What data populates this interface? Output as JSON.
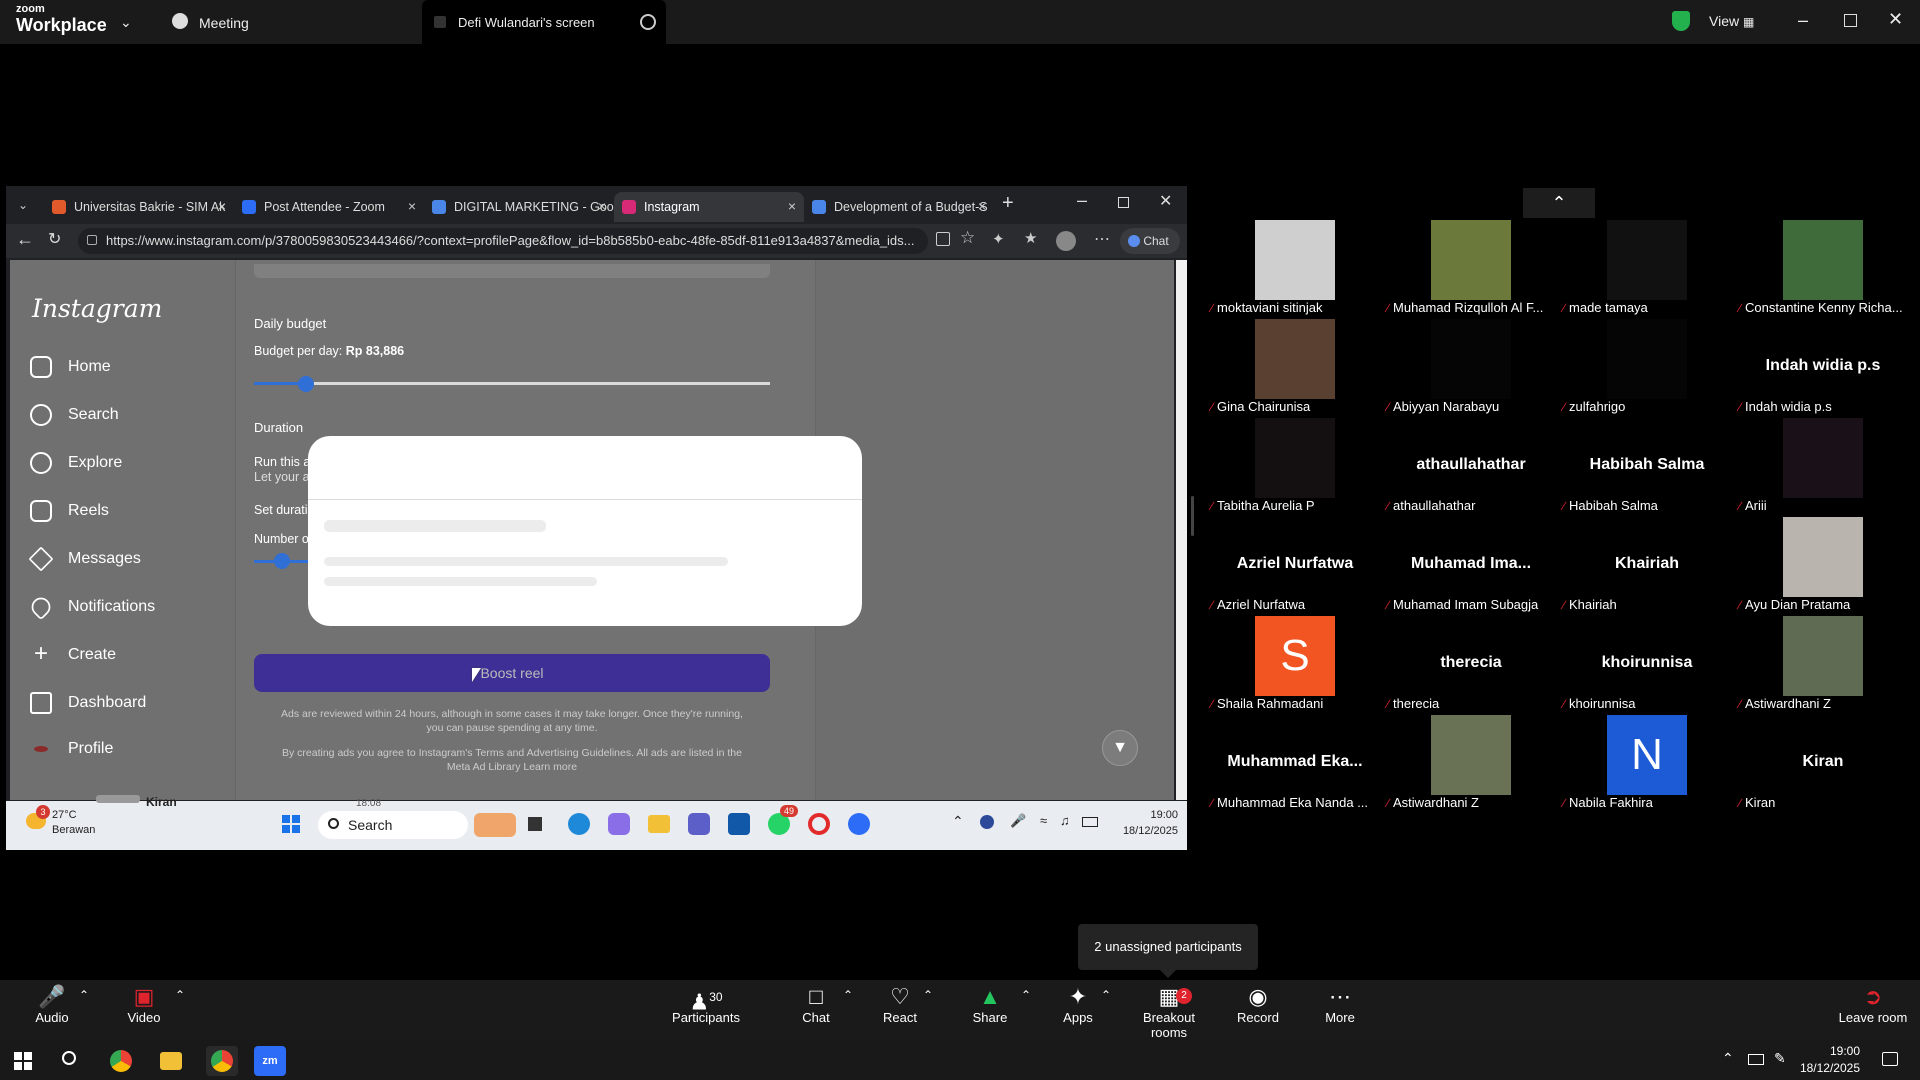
{
  "zoom": {
    "logo_top": "zoom",
    "logo_bottom": "Workplace",
    "meeting_label": "Meeting",
    "share_tab_label": "Defi Wulandari's screen",
    "view_label": "View"
  },
  "browser": {
    "tabs": [
      {
        "label": "Universitas Bakrie - SIM Ak",
        "color": "#e05a2b"
      },
      {
        "label": "Post Attendee - Zoom",
        "color": "#2d6cf6"
      },
      {
        "label": "DIGITAL MARKETING - Goo",
        "color": "#4a86e8"
      },
      {
        "label": "Instagram",
        "color": "#d62976"
      },
      {
        "label": "Development of a Budget-S",
        "color": "#4a86e8"
      }
    ],
    "url": "https://www.instagram.com/p/3780059830523443466/?context=profilePage&flow_id=b8b585b0-eabc-48fe-85df-811e913a4837&media_ids...",
    "chat_label": "Chat"
  },
  "instagram": {
    "logo": "Instagram",
    "nav": [
      "Home",
      "Search",
      "Explore",
      "Reels",
      "Messages",
      "Notifications",
      "Create",
      "Dashboard",
      "Profile"
    ],
    "daily_budget_label": "Daily budget",
    "budget_per_day_label": "Budget per day:",
    "budget_value": "Rp 83,886",
    "duration_label": "Duration",
    "run_this_label": "Run this ad",
    "let_your_label": "Let your ad",
    "set_duration_label": "Set duration",
    "number_of_label": "Number of",
    "boost_button": "Boost reel",
    "review_text_1": "Ads are reviewed within 24 hours, although in some cases it may take longer. Once they're running,",
    "review_text_2": "you can pause spending at any time.",
    "terms_text_1": "By creating ads you agree to Instagram's Terms and Advertising Guidelines. All ads are listed in the",
    "terms_text_2": "Meta Ad Library Learn more",
    "budget_slider_level": 0.1
  },
  "inner_taskbar": {
    "weather_temp": "27°C",
    "weather_desc": "Berawan",
    "search_label": "Search",
    "time": "19:00",
    "date": "18/12/2025",
    "badge": "49",
    "notif": "3",
    "peek_name": "Kiran",
    "peek_time": "18:08"
  },
  "participants": [
    {
      "name": "moktaviani sitinjak",
      "type": "video",
      "color": "#cfcfcf"
    },
    {
      "name": "Muhamad Rizqulloh Al F...",
      "type": "video",
      "color": "#6b7a3a"
    },
    {
      "name": "made tamaya",
      "type": "video",
      "color": "#111111"
    },
    {
      "name": "Constantine Kenny Richa...",
      "type": "video",
      "color": "#3f6a3a"
    },
    {
      "name": "Gina Chairunisa",
      "type": "video",
      "color": "#5a4030"
    },
    {
      "name": "Abiyyan Narabayu",
      "type": "video",
      "color": "#050505"
    },
    {
      "name": "zulfahrigo",
      "type": "video",
      "color": "#050505"
    },
    {
      "name": "Indah widia p.s",
      "type": "text",
      "big": "Indah widia p.s"
    },
    {
      "name": "Tabitha Aurelia P",
      "type": "video",
      "color": "#141012"
    },
    {
      "name": "athaullahathar",
      "type": "text",
      "big": "athaullahathar"
    },
    {
      "name": "Habibah Salma",
      "type": "text",
      "big": "Habibah Salma"
    },
    {
      "name": "Ariii",
      "type": "video",
      "color": "#1a1018"
    },
    {
      "name": "Azriel Nurfatwa",
      "type": "text",
      "big": "Azriel Nurfatwa"
    },
    {
      "name": "Muhamad Imam Subagja",
      "type": "text",
      "big": "Muhamad  Ima..."
    },
    {
      "name": "Khairiah",
      "type": "text",
      "big": "Khairiah"
    },
    {
      "name": "Ayu Dian Pratama",
      "type": "video",
      "color": "#b9b4ad"
    },
    {
      "name": "Shaila Rahmadani",
      "type": "avatar",
      "letter": "S",
      "color": "#f25522"
    },
    {
      "name": "therecia",
      "type": "text",
      "big": "therecia"
    },
    {
      "name": "khoirunnisa",
      "type": "text",
      "big": "khoirunnisa"
    },
    {
      "name": "Astiwardhani Z",
      "type": "video",
      "color": "#5f6b52"
    },
    {
      "name": "Muhammad Eka Nanda ...",
      "type": "text",
      "big": "Muhammad  Eka..."
    },
    {
      "name": "Astiwardhani Z",
      "type": "video",
      "color": "#6a7256"
    },
    {
      "name": "Nabila Fakhira",
      "type": "avatar",
      "letter": "N",
      "color": "#1d5bd6"
    },
    {
      "name": "Kiran",
      "type": "text",
      "big": "Kiran"
    }
  ],
  "toast": "2 unassigned participants",
  "toolbar": {
    "audio": "Audio",
    "video": "Video",
    "participants": "Participants",
    "participants_count": "30",
    "chat": "Chat",
    "react": "React",
    "share": "Share",
    "apps": "Apps",
    "breakout": "Breakout rooms",
    "breakout_badge": "2",
    "record": "Record",
    "more": "More",
    "leave": "Leave room"
  },
  "windows": {
    "time": "19:00",
    "date": "18/12/2025"
  }
}
